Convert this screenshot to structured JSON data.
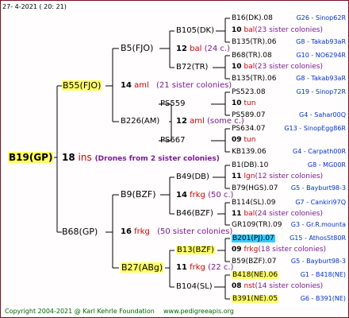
{
  "header": {
    "date": "27-  4-2021 ( 20: 21)"
  },
  "colors": {
    "line": "#000000",
    "highlight": "#ffff66",
    "cyan": "#33ccff",
    "accent": "#cc0000",
    "note": "#7a1a90",
    "link": "#0033cc",
    "footer": "#006600"
  },
  "gen1": {
    "name": "B19(GP)",
    "count": "18",
    "unit": "ins",
    "note": "(Drones from 2 sister colonies)"
  },
  "gen2": [
    {
      "name": "B55(FJO)",
      "count": "14",
      "unit": "aml",
      "note": "(21 sister colonies)"
    },
    {
      "name": "B68(GP)",
      "count": "16",
      "unit": "frkg",
      "note": "(50 sister colonies)"
    }
  ],
  "gen3": [
    {
      "name": "B5(FJO)"
    },
    {
      "name": "B226(AM)",
      "count": "12",
      "unit": "aml",
      "note": "(some c.)"
    },
    {
      "name": "B9(BZF)"
    },
    {
      "name": "B27(ABg)",
      "count": "11",
      "unit": "frkg",
      "note": "(22 c.)"
    }
  ],
  "gen4": [
    {
      "name": "B105(DK)",
      "count": "12",
      "unit": "bal",
      "note": "(24 c.)"
    },
    {
      "name": "B72(TR)"
    },
    {
      "name": "PS559"
    },
    {
      "name": "PS667"
    },
    {
      "name": "B49(DB)",
      "count": "14",
      "unit": "frkg",
      "note": "(50 c.)"
    },
    {
      "name": "B46(BZF)"
    },
    {
      "name": "B13(BZF)"
    },
    {
      "name": "B104(SL)"
    }
  ],
  "gen5": [
    {
      "left": "B16(DK).08",
      "right": "G26 - Sinop62R"
    },
    {
      "count": "10",
      "unit": "bal",
      "note": "(23 sister colonies)"
    },
    {
      "left": "B135(TR).06",
      "right": "G8 - Takab93aR"
    },
    {
      "left": "B68(TR).08",
      "right": "G10 - NO6294R"
    },
    {
      "count": "10",
      "unit": "bal",
      "note": "(23 sister colonies)"
    },
    {
      "left": "B135(TR).06",
      "right": "G8 - Takab93aR"
    },
    {
      "left": "PS523.08",
      "right": "G19 - Sinop72R"
    },
    {
      "count": "10",
      "unit": "tun",
      "note": ""
    },
    {
      "left": "PS589.07",
      "right": "G4 - Sahar00Q"
    },
    {
      "left": "PS634.07",
      "right": "G13 - SinopEgg86R"
    },
    {
      "count": "09",
      "unit": "tun",
      "note": ""
    },
    {
      "left": "KB139.06",
      "right": "G4 - Carpath00R"
    },
    {
      "left": "B1(DB).10",
      "right": "G8 - MG00R"
    },
    {
      "count": "11",
      "unit": "lgn",
      "note": "(12 sister colonies)"
    },
    {
      "left": "B79(HGS).07",
      "right": "G5 - Bayburt98-3"
    },
    {
      "left": "B114(SL).09",
      "right": "G7 - Cankiri97Q"
    },
    {
      "count": "11",
      "unit": "bal",
      "note": "(24 sister colonies)"
    },
    {
      "left": "GR109(TR).09",
      "right": "G3 - Gr.R.mounta"
    },
    {
      "left": "B201(PJ).07",
      "right": "G15 - AthosSt80R"
    },
    {
      "count": "09",
      "unit": "frkg",
      "note": "(18 sister colonies)"
    },
    {
      "left": "B59(BZF).07",
      "right": "G5 - Bayburt98-3"
    },
    {
      "left": "B418(NE).06",
      "right": "G1 - B418(NE)"
    },
    {
      "count": "08",
      "unit": "nst",
      "note": "(14 sister colonies)"
    },
    {
      "left": "B391(NE).05",
      "right": "G6 - B391(NE)"
    }
  ],
  "footer": {
    "copyright": "Copyright 2004-2021 @ Karl Kehrle Foundation",
    "site": "www.pedigreeapis.org"
  }
}
